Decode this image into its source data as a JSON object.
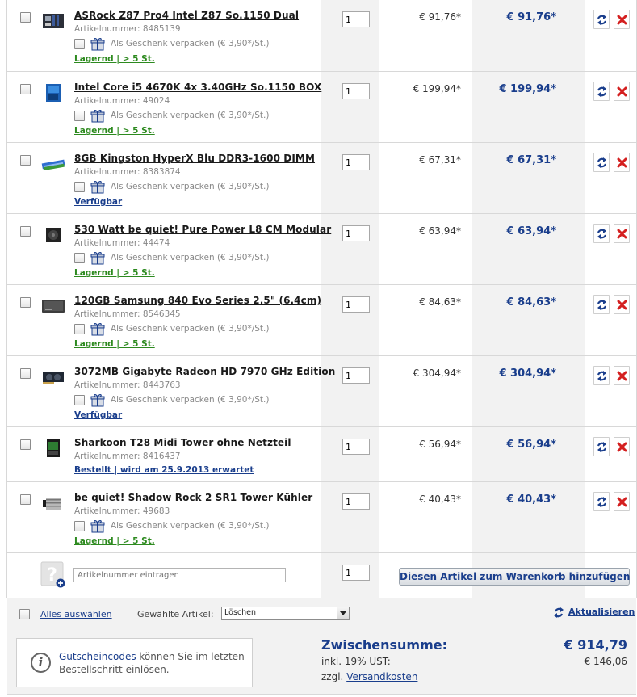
{
  "items": [
    {
      "name": "ASRock Z87 Pro4 Intel Z87 So.1150 Dual",
      "article_number": "Artikelnummer: 8485139",
      "gift_wrap": "Als Geschenk verpacken (€ 3,90*/St.)",
      "availability": "Lagernd | > 5 St.",
      "availability_status": "in-stock",
      "quantity": "1",
      "unit_price": "€ 91,76*",
      "total_price": "€ 91,76*",
      "thumb": "motherboard-thumbnail"
    },
    {
      "name": "Intel Core i5 4670K 4x 3.40GHz So.1150 BOX",
      "article_number": "Artikelnummer: 49024",
      "gift_wrap": "Als Geschenk verpacken (€ 3,90*/St.)",
      "availability": "Lagernd | > 5 St.",
      "availability_status": "in-stock",
      "quantity": "1",
      "unit_price": "€ 199,94*",
      "total_price": "€ 199,94*",
      "thumb": "cpu-box-thumbnail"
    },
    {
      "name": "8GB Kingston HyperX Blu DDR3-1600 DIMM",
      "article_number": "Artikelnummer: 8383874",
      "gift_wrap": "Als Geschenk verpacken (€ 3,90*/St.)",
      "availability": "Verfügbar",
      "availability_status": "available",
      "quantity": "1",
      "unit_price": "€ 67,31*",
      "total_price": "€ 67,31*",
      "thumb": "ram-thumbnail"
    },
    {
      "name": "530 Watt be quiet! Pure Power L8 CM Modular",
      "article_number": "Artikelnummer: 44474",
      "gift_wrap": "Als Geschenk verpacken (€ 3,90*/St.)",
      "availability": "Lagernd | > 5 St.",
      "availability_status": "in-stock",
      "quantity": "1",
      "unit_price": "€ 63,94*",
      "total_price": "€ 63,94*",
      "thumb": "psu-thumbnail"
    },
    {
      "name": "120GB Samsung 840 Evo Series 2.5\" (6.4cm)",
      "article_number": "Artikelnummer: 8546345",
      "gift_wrap": "Als Geschenk verpacken (€ 3,90*/St.)",
      "availability": "Lagernd | > 5 St.",
      "availability_status": "in-stock",
      "quantity": "1",
      "unit_price": "€ 84,63*",
      "total_price": "€ 84,63*",
      "thumb": "ssd-thumbnail"
    },
    {
      "name": "3072MB Gigabyte Radeon HD 7970 GHz Edition",
      "article_number": "Artikelnummer: 8443763",
      "gift_wrap": "Als Geschenk verpacken (€ 3,90*/St.)",
      "availability": "Verfügbar",
      "availability_status": "available",
      "quantity": "1",
      "unit_price": "€ 304,94*",
      "total_price": "€ 304,94*",
      "thumb": "graphics-card-thumbnail"
    },
    {
      "name": "Sharkoon T28 Midi Tower ohne Netzteil",
      "article_number": "Artikelnummer: 8416437",
      "gift_wrap": "",
      "availability": "Bestellt | wird am 25.9.2013 erwartet",
      "availability_status": "ordered",
      "quantity": "1",
      "unit_price": "€ 56,94*",
      "total_price": "€ 56,94*",
      "thumb": "case-thumbnail"
    },
    {
      "name": "be quiet! Shadow Rock 2 SR1 Tower Kühler",
      "article_number": "Artikelnummer: 49683",
      "gift_wrap": "Als Geschenk verpacken (€ 3,90*/St.)",
      "availability": "Lagernd | > 5 St.",
      "availability_status": "in-stock",
      "quantity": "1",
      "unit_price": "€ 40,43*",
      "total_price": "€ 40,43*",
      "thumb": "cpu-cooler-thumbnail"
    }
  ],
  "add_item": {
    "placeholder": "Artikelnummer eintragen",
    "quantity": "1",
    "button_label": "Diesen Artikel zum Warenkorb hinzufügen"
  },
  "bulk": {
    "select_all_label": "Alles auswählen",
    "chosen_label": "Gewählte Artikel:",
    "action_selected": "Löschen",
    "update_label": "Aktualisieren"
  },
  "summary": {
    "voucher_link": "Gutscheincodes",
    "voucher_text": " können Sie im letzten Bestellschritt einlösen.",
    "subtotal_label": "Zwischensumme:",
    "subtotal_value": "€ 914,79",
    "vat_label": "inkl. 19% UST:",
    "vat_value": "€ 146,06",
    "shipping_prefix": "zzgl. ",
    "shipping_link": "Versandkosten"
  },
  "colors": {
    "accent": "#1a3e8c",
    "in_stock": "#2d8a1f",
    "delete": "#d42020",
    "panel": "#f2f2f2"
  }
}
